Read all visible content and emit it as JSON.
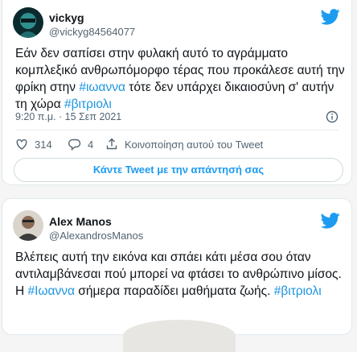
{
  "tweet1": {
    "name": "vickyg",
    "handle": "@vickyg84564077",
    "text_parts": [
      "Εάν δεν σαπίσει στην φυλακή αυτό το αγράμματο κομπλεξικό ανθρωπόμορφο τέρας που προκάλεσε αυτή την φρίκη στην ",
      "#ιωαννα",
      " τότε δεν υπάρχει δικαιοσύνη σ' αυτήν τη χώρα ",
      "#βιτριολι"
    ],
    "timestamp": "9:20 π.μ. · 15 Σεπ 2021",
    "likes": "314",
    "replies": "4",
    "share_label": "Κοινοποίηση αυτού του Tweet",
    "reply_button": "Κάντε Tweet με την απάντησή σας"
  },
  "tweet2": {
    "name": "Alex Manos",
    "handle": "@AlexandrosManos",
    "text_parts": [
      "Βλέπεις αυτή την εικόνα και σπάει κάτι μέσα σου όταν αντιλαμβάνεσαι πού μπορεί να φτάσει το ανθρώπινο μίσος. Η ",
      "#Ιωαννα",
      " σήμερα παραδίδει μαθήματα ζωής. ",
      "#βιτριολι"
    ]
  },
  "colors": {
    "accent": "#1d9bf0",
    "hashtag": "#1b95e0",
    "heart": "#536471"
  },
  "icons": [
    "twitter-bird-icon",
    "info-icon",
    "heart-icon",
    "reply-icon",
    "share-icon"
  ]
}
